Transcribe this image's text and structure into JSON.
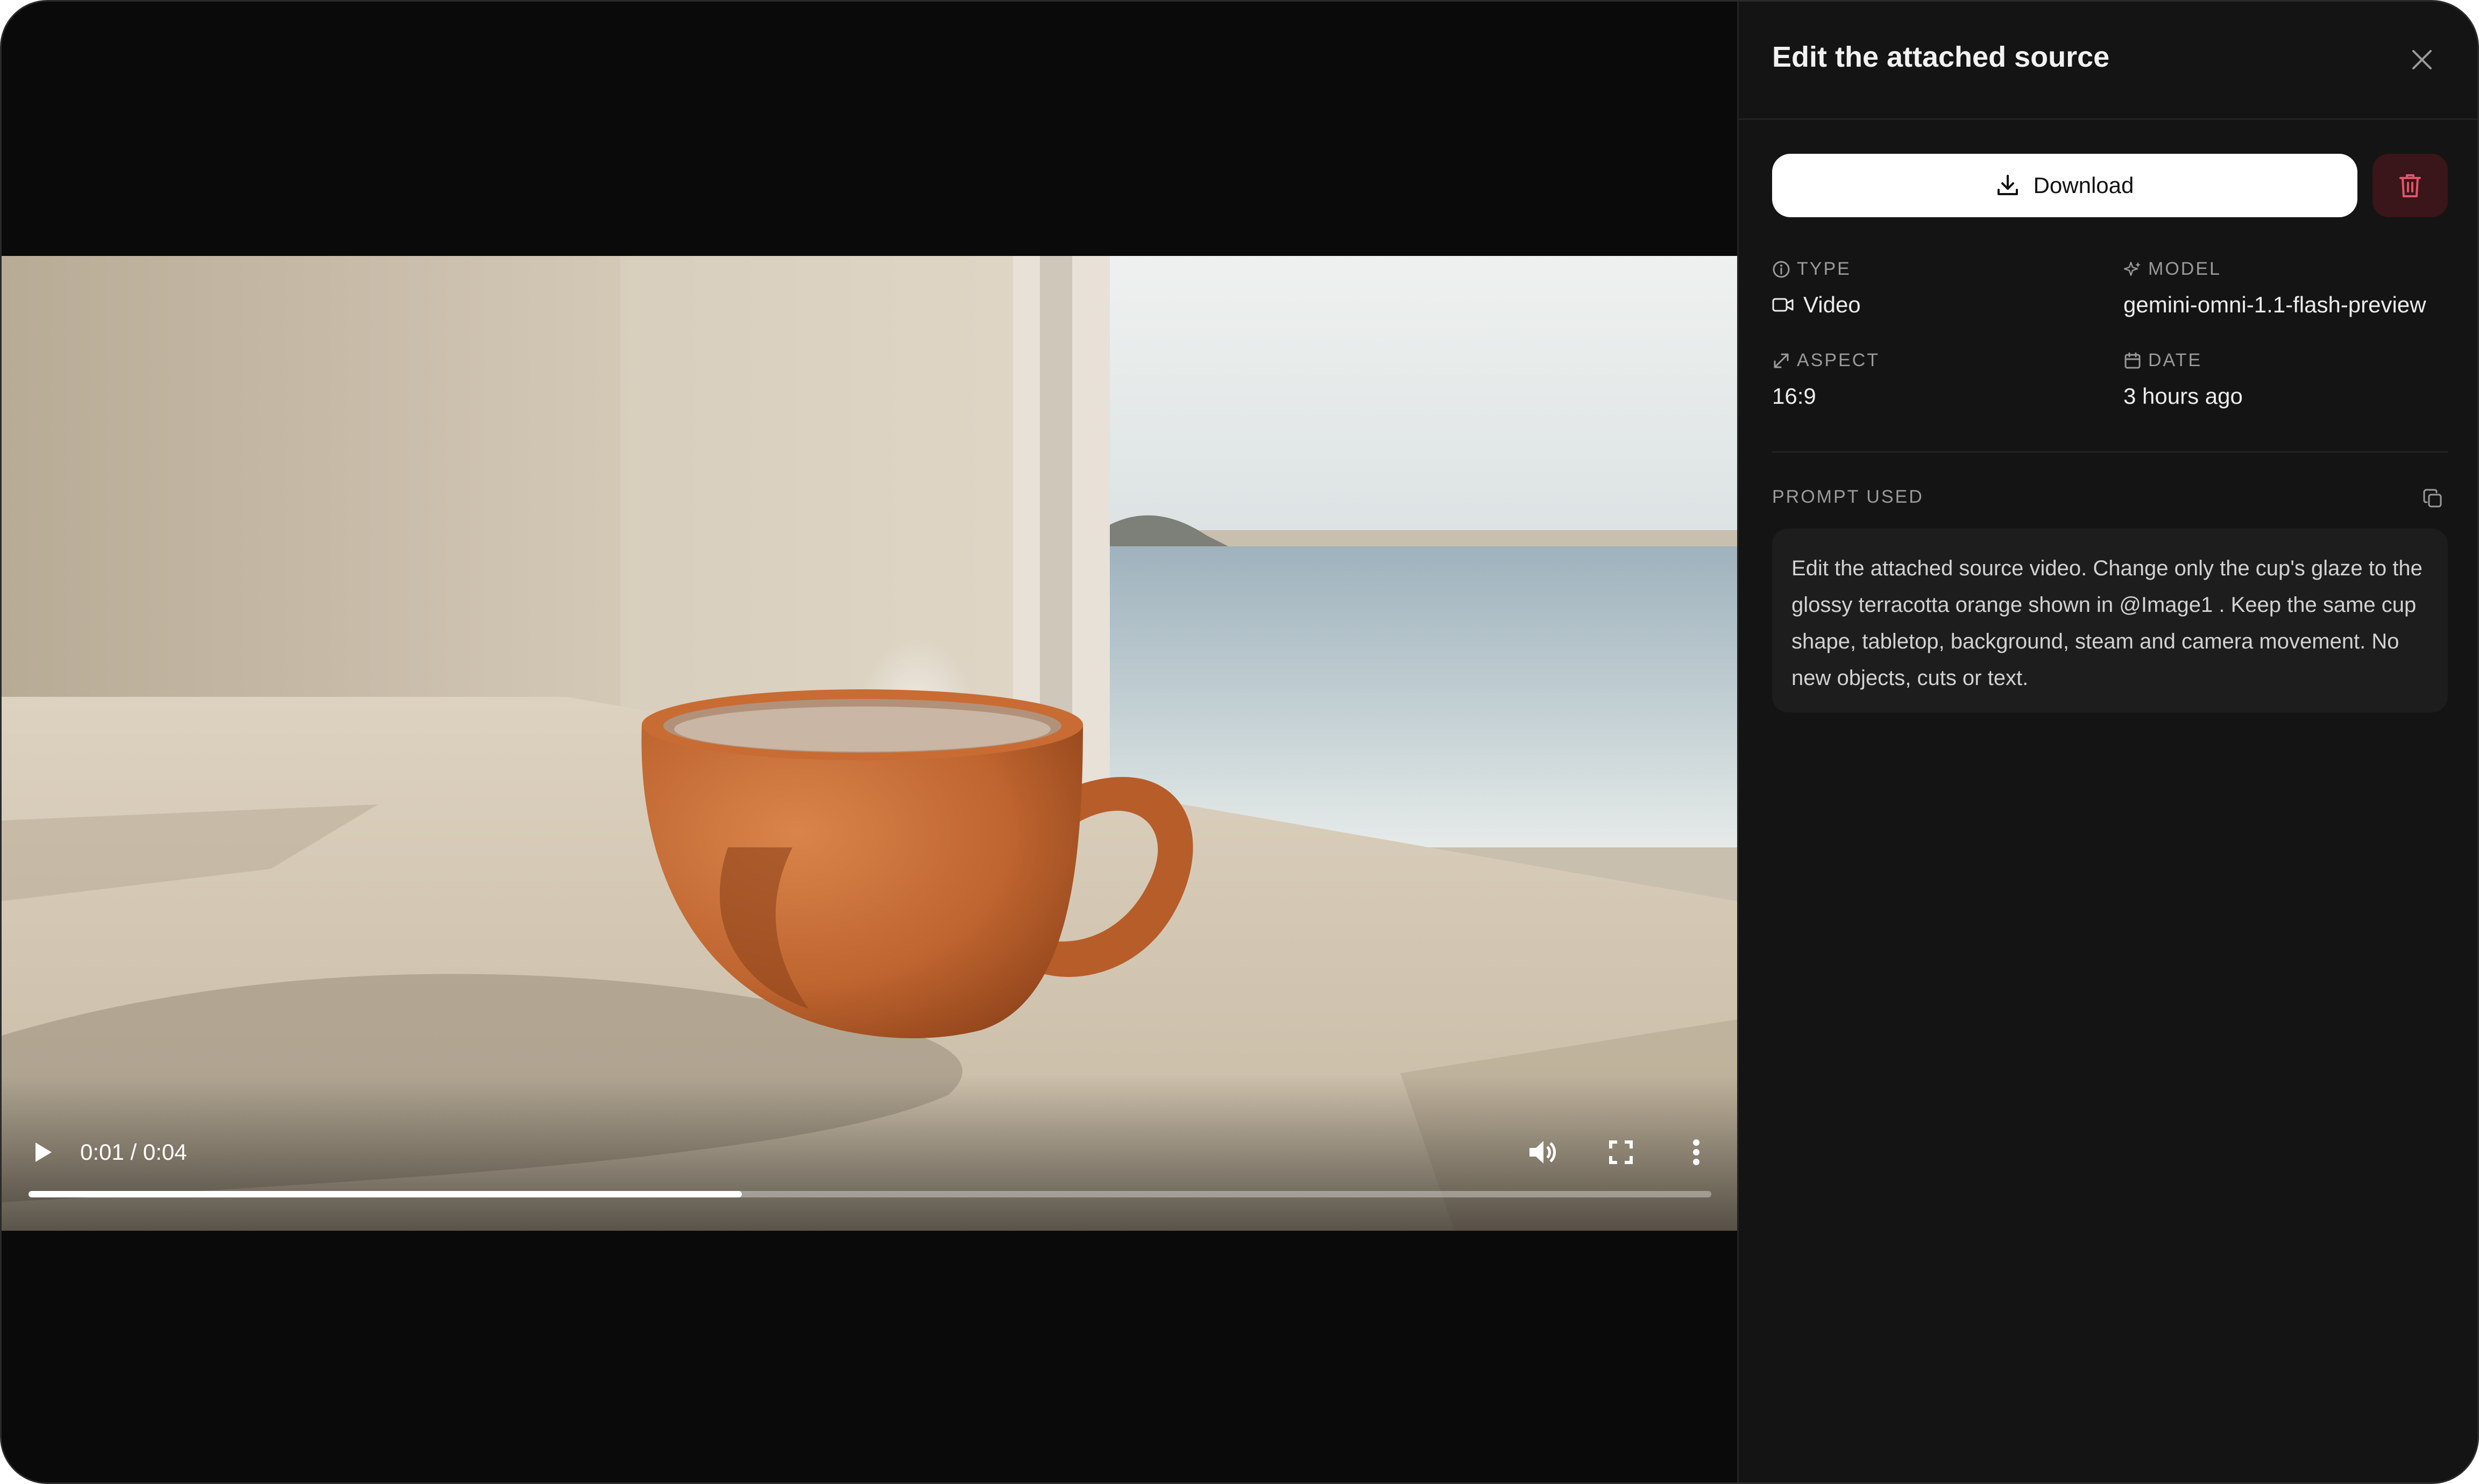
{
  "video": {
    "time_display": "0:01 / 0:04",
    "progress_fraction": 0.424
  },
  "panel": {
    "title": "Edit the attached source",
    "download_label": "Download",
    "meta": {
      "type_label": "TYPE",
      "type_value": "Video",
      "model_label": "MODEL",
      "model_value": "gemini-omni-1.1-flash-preview",
      "aspect_label": "ASPECT",
      "aspect_value": "16:9",
      "date_label": "DATE",
      "date_value": "3 hours ago"
    },
    "prompt_label": "PROMPT USED",
    "prompt_text": "Edit the attached source video. Change only the cup's glaze to the glossy terracotta orange shown in @Image1 . Keep the same cup shape, tabletop, background, steam and camera movement. No new objects, cuts or text."
  },
  "icons": {
    "play": "play-icon",
    "volume": "volume-icon",
    "fullscreen": "fullscreen-icon",
    "more": "more-vertical-icon",
    "close": "close-icon",
    "download": "download-icon",
    "delete": "trash-icon",
    "type": "info-icon",
    "video": "video-camera-icon",
    "model": "sparkle-icon",
    "aspect": "expand-icon",
    "date": "calendar-icon",
    "copy": "copy-icon"
  },
  "colors": {
    "panel_bg": "#141414",
    "video_bg": "#0a0a0a",
    "delete_bg": "#3a1519",
    "delete_icon": "#e0566a",
    "cup": "#c1662e"
  }
}
